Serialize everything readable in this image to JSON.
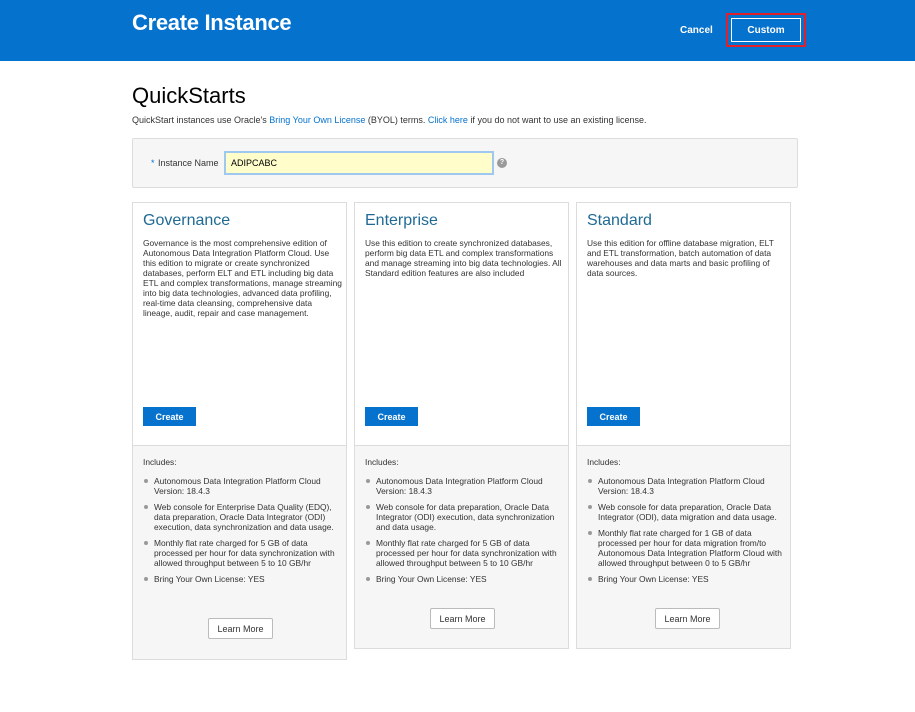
{
  "header": {
    "title": "Create Instance",
    "cancel_label": "Cancel",
    "custom_label": "Custom"
  },
  "colors": {
    "brand_blue": "#0572ce",
    "highlight_red": "#e0202a",
    "input_bg": "#fffecb",
    "card_title": "#1f6a94"
  },
  "quickstarts": {
    "heading": "QuickStarts",
    "intro_before": "QuickStart instances use Oracle's",
    "byol_link": "Bring Your Own License",
    "intro_middle": "(BYOL) terms.",
    "click_here_link": "Click here",
    "intro_after": "if you do not want to use an existing license."
  },
  "instance_name": {
    "required_marker": "*",
    "label": "Instance Name",
    "value": "ADIPCABC",
    "help_icon": "?"
  },
  "editions": [
    {
      "name": "Governance",
      "description": "Governance is the most comprehensive edition of Autonomous Data Integration Platform Cloud. Use this edition to migrate or create synchronized databases, perform ELT and ETL including big data ETL and complex transformations, manage streaming into big data technologies, advanced data profiling, real-time data cleansing, comprehensive data lineage, audit, repair and case management.",
      "create_label": "Create",
      "includes_label": "Includes:",
      "includes": [
        "Autonomous Data Integration Platform Cloud Version: 18.4.3",
        "Web console for Enterprise Data Quality (EDQ), data preparation, Oracle Data Integrator (ODI) execution, data synchronization and data usage.",
        "Monthly flat rate charged for 5 GB of data processed per hour for data synchronization with allowed throughput between 5 to 10 GB/hr",
        "Bring Your Own License: YES"
      ],
      "learn_more_label": "Learn More"
    },
    {
      "name": "Enterprise",
      "description": "Use this edition to create synchronized databases, perform big data ETL and complex transformations and manage streaming into big data technologies. All Standard edition features are also included",
      "create_label": "Create",
      "includes_label": "Includes:",
      "includes": [
        "Autonomous Data Integration Platform Cloud Version: 18.4.3",
        "Web console for data preparation, Oracle Data Integrator (ODI) execution, data synchronization and data usage.",
        "Monthly flat rate charged for 5 GB of data processed per hour for data synchronization with allowed throughput between 5 to 10 GB/hr",
        "Bring Your Own License: YES"
      ],
      "learn_more_label": "Learn More"
    },
    {
      "name": "Standard",
      "description": "Use this edition for offline database migration, ELT and ETL transformation, batch automation of data warehouses and data marts and basic profiling of data sources.",
      "create_label": "Create",
      "includes_label": "Includes:",
      "includes": [
        "Autonomous Data Integration Platform Cloud Version: 18.4.3",
        "Web console for data preparation, Oracle Data Integrator (ODI), data migration and data usage.",
        "Monthly flat rate charged for 1 GB of data processed per hour for data migration from/to Autonomous Data Integration Platform Cloud with allowed throughput between 0 to 5 GB/hr",
        "Bring Your Own License: YES"
      ],
      "learn_more_label": "Learn More"
    }
  ]
}
